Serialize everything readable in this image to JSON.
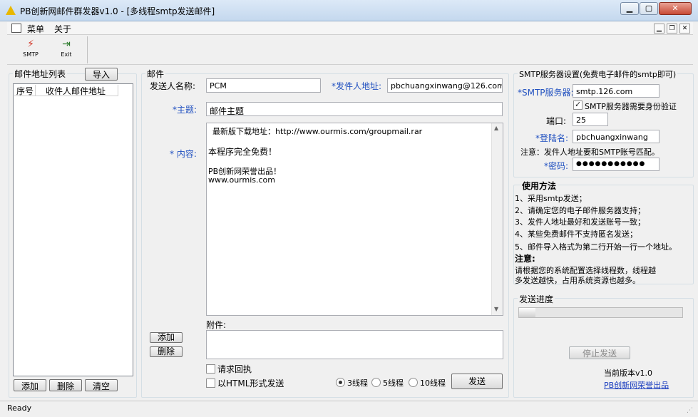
{
  "window": {
    "title": "PB创新网邮件群发器v1.0 - [多线程smtp发送邮件]"
  },
  "menu": {
    "items": [
      "菜单",
      "关于"
    ]
  },
  "toolbar": {
    "smtp_label": "SMTP",
    "exit_label": "Exit"
  },
  "address_list": {
    "title": "邮件地址列表",
    "import_label": "导入",
    "columns": [
      "序号",
      "收件人邮件地址"
    ],
    "add_label": "添加",
    "delete_label": "删除",
    "clear_label": "清空"
  },
  "mail": {
    "title": "邮件",
    "sender_name_label": "发送人名称:",
    "sender_name_value": "PCM",
    "sender_addr_label": "*发件人地址:",
    "sender_addr_value": "pbchuangxinwang@126.com",
    "subject_label": "*主题:",
    "subject_value": "邮件主题",
    "content_label": "* 内容:",
    "content_line1": "最新版下载地址：http://www.ourmis.com/groupmail.rar",
    "content_line2": "本程序完全免费！",
    "content_line3": "PB创新网荣誉出品！",
    "content_line4": "www.ourmis.com",
    "attach_label": "附件:",
    "attach_add_label": "添加",
    "attach_delete_label": "删除",
    "receipt_label": "请求回执",
    "html_label": "以HTML形式发送",
    "thread_options": [
      "3线程",
      "5线程",
      "10线程"
    ],
    "send_label": "发送"
  },
  "smtp": {
    "title": "SMTP服务器设置(免费电子邮件的smtp即可)",
    "server_label": "*SMTP服务器:",
    "server_value": "smtp.126.com",
    "auth_label": "SMTP服务器需要身份验证",
    "port_label": "端口:",
    "port_value": "25",
    "login_label": "*登陆名:",
    "login_value": "pbchuangxinwang",
    "note": "注意：发件人地址要和SMTP账号匹配。",
    "password_label": "*密码:",
    "password_value": "●●●●●●●●●●●"
  },
  "usage": {
    "title": "使用方法",
    "lines": [
      "1、采用smtp发送；",
      "2、请确定您的电子邮件服务器支持；",
      "3、发件人地址最好和发送账号一致；",
      "4、某些免费邮件不支持匿名发送；",
      "5、邮件导入格式为第二行开始一行一个地址。"
    ],
    "note_title": "注意:",
    "note_line1": "请根据您的系统配置选择线程数，线程越",
    "note_line2": "多发送越快，占用系统资源也越多。"
  },
  "progress": {
    "title": "发送进度",
    "value_percent": 10,
    "stop_label": "停止发送"
  },
  "version": {
    "label": "当前版本v1.0",
    "link": "PB创新网荣誉出品"
  },
  "status": {
    "text": "Ready"
  },
  "colors": {
    "accent": "#2050c0",
    "link": "#1a3dbf"
  }
}
